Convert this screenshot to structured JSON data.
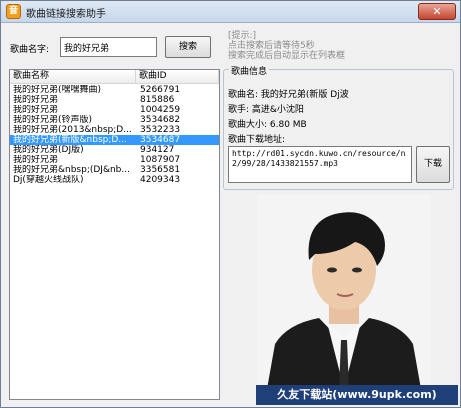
{
  "window": {
    "title": "歌曲链接搜索助手",
    "app_icon": "音"
  },
  "search": {
    "label": "歌曲名字:",
    "value": "我的好兄弟",
    "button": "搜索"
  },
  "tips": [
    "[提示:]",
    "点击搜索后请等待5秒",
    "搜索完成后自动显示在列表框"
  ],
  "list": {
    "columns": [
      "歌曲名称",
      "歌曲ID"
    ],
    "rows": [
      {
        "name": "我的好兄弟(嘿嘿舞曲)",
        "id": "5266791"
      },
      {
        "name": "我的好兄弟",
        "id": "815886"
      },
      {
        "name": "我的好兄弟",
        "id": "1004259"
      },
      {
        "name": "我的好兄弟(铃声版)",
        "id": "3534682"
      },
      {
        "name": "我的好兄弟(2013&nbsp;D...",
        "id": "3532233"
      },
      {
        "name": "我的好兄弟(新版&nbsp;D...",
        "id": "3534687",
        "selected": true
      },
      {
        "name": "我的好兄弟(DJ版)",
        "id": "934127"
      },
      {
        "name": "我的好兄弟",
        "id": "1087907"
      },
      {
        "name": "我的好兄弟&nbsp;(DJ&nb...",
        "id": "3356581"
      },
      {
        "name": "Dj(穿越火线战队)",
        "id": "4209343"
      }
    ]
  },
  "info": {
    "group_title": "歌曲信息",
    "song_name": "歌曲名: 我的好兄弟(新版 Dj波",
    "singer": "歌手: 高进&小沈阳",
    "size": "歌曲大小: 6.80 MB",
    "url_label": "歌曲下载地址:",
    "url": "http://rd01.sycdn.kuwo.cn/resource/n2/99/28/1433821557.mp3",
    "download_button": "下载"
  },
  "watermark": "久友下载站(www.9upk.com)"
}
